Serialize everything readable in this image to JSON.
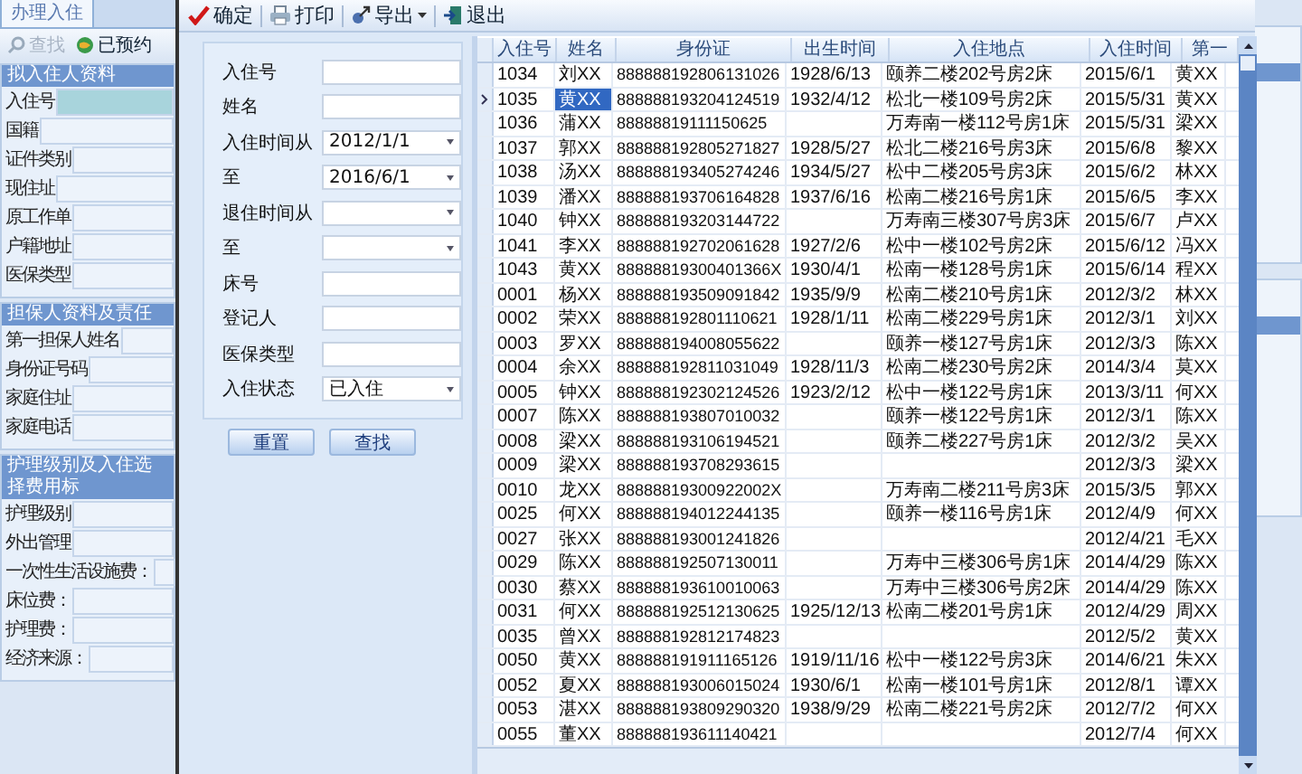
{
  "background_window": {
    "tab": {
      "label": "办理入住",
      "selected": true
    },
    "toolbar": [
      {
        "label": "查找",
        "kind": "search",
        "disabled": true
      },
      {
        "label": "已预约",
        "kind": "booked",
        "disabled": false
      }
    ],
    "sections": [
      {
        "title": "拟入住人资料",
        "fields": [
          {
            "label": "入住号",
            "highlighted": true
          },
          {
            "label": "国籍",
            "highlighted": false
          },
          {
            "label": "证件类别",
            "highlighted": false
          },
          {
            "label": "现住址",
            "highlighted": false
          },
          {
            "label": "原工作单",
            "highlighted": false
          },
          {
            "label": "户籍地址",
            "highlighted": false
          },
          {
            "label": "医保类型",
            "highlighted": false
          }
        ]
      },
      {
        "title": "担保人资料及责任",
        "fields": [
          {
            "label": "第一担保人姓名",
            "highlighted": false
          },
          {
            "label": "身份证号码",
            "highlighted": false
          },
          {
            "label": "家庭住址",
            "highlighted": false
          },
          {
            "label": "家庭电话",
            "highlighted": false
          }
        ]
      },
      {
        "title": "护理级别及入住选择费用标",
        "fields": [
          {
            "label": "护理级别",
            "highlighted": false
          },
          {
            "label": "外出管理",
            "highlighted": false
          },
          {
            "label": "一次性生活设施费：",
            "highlighted": false
          },
          {
            "label": "床位费：",
            "highlighted": false
          },
          {
            "label": "护理费：",
            "highlighted": false
          },
          {
            "label": "经济来源：",
            "highlighted": false
          }
        ]
      }
    ]
  },
  "dialog": {
    "toolbar": [
      {
        "label": "确定",
        "kind": "confirm",
        "dropdown": false
      },
      {
        "label": "打印",
        "kind": "print",
        "dropdown": false
      },
      {
        "label": "导出",
        "kind": "export",
        "dropdown": true
      },
      {
        "label": "退出",
        "kind": "exit",
        "dropdown": false
      }
    ],
    "filters": [
      {
        "label": "入住号",
        "kind": "text"
      },
      {
        "label": "姓名",
        "kind": "text"
      },
      {
        "label": "入住时间从",
        "kind": "combo",
        "value": "2012/1/1"
      },
      {
        "label": "至",
        "kind": "combo",
        "value": "2016/6/1"
      },
      {
        "label": "退住时间从",
        "kind": "combo"
      },
      {
        "label": "至",
        "kind": "combo"
      },
      {
        "label": "床号",
        "kind": "text"
      },
      {
        "label": "登记人",
        "kind": "text"
      },
      {
        "label": "医保类型",
        "kind": "text"
      },
      {
        "label": "入住状态",
        "kind": "combo",
        "value": "已入住"
      }
    ],
    "buttons": [
      "重置",
      "查找"
    ],
    "table": {
      "columns": [
        "入住号",
        "姓名",
        "身份证",
        "出生时间",
        "入住地点",
        "入住时间",
        "第一"
      ],
      "rows": [
        {
          "selected": false,
          "cells": [
            "1034",
            "刘XX",
            "888888192806131026",
            "1928/6/13",
            "颐养二楼202号房2床",
            "2015/6/1",
            "黄XX"
          ]
        },
        {
          "selected": true,
          "cells": [
            "1035",
            "黄XX",
            "888888193204124519",
            "1932/4/12",
            "松北一楼109号房2床",
            "2015/5/31",
            "黄XX"
          ]
        },
        {
          "selected": false,
          "cells": [
            "1036",
            "蒲XX",
            "88888819111150625",
            null,
            "万寿南一楼112号房1床",
            "2015/5/31",
            "梁XX"
          ]
        },
        {
          "selected": false,
          "cells": [
            "1037",
            "郭XX",
            "888888192805271827",
            "1928/5/27",
            "松北二楼216号房3床",
            "2015/6/8",
            "黎XX"
          ]
        },
        {
          "selected": false,
          "cells": [
            "1038",
            "汤XX",
            "888888193405274246",
            "1934/5/27",
            "松中二楼205号房3床",
            "2015/6/2",
            "林XX"
          ]
        },
        {
          "selected": false,
          "cells": [
            "1039",
            "潘XX",
            "888888193706164828",
            "1937/6/16",
            "松南二楼216号房1床",
            "2015/6/5",
            "李XX"
          ]
        },
        {
          "selected": false,
          "cells": [
            "1040",
            "钟XX",
            "888888193203144722",
            null,
            "万寿南三楼307号房3床",
            "2015/6/7",
            "卢XX"
          ]
        },
        {
          "selected": false,
          "cells": [
            "1041",
            "李XX",
            "888888192702061628",
            "1927/2/6",
            "松中一楼102号房2床",
            "2015/6/12",
            "冯XX"
          ]
        },
        {
          "selected": false,
          "cells": [
            "1043",
            "黄XX",
            "88888819300401366X",
            "1930/4/1",
            "松南一楼128号房1床",
            "2015/6/14",
            "程XX"
          ]
        },
        {
          "selected": false,
          "cells": [
            "0001",
            "杨XX",
            "888888193509091842",
            "1935/9/9",
            "松南二楼210号房1床",
            "2012/3/2",
            "林XX"
          ]
        },
        {
          "selected": false,
          "cells": [
            "0002",
            "荣XX",
            "888888192801110621",
            "1928/1/11",
            "松南二楼229号房1床",
            "2012/3/1",
            "刘XX"
          ]
        },
        {
          "selected": false,
          "cells": [
            "0003",
            "罗XX",
            "888888194008055622",
            null,
            "颐养一楼127号房1床",
            "2012/3/3",
            "陈XX"
          ]
        },
        {
          "selected": false,
          "cells": [
            "0004",
            "余XX",
            "888888192811031049",
            "1928/11/3",
            "松南二楼230号房2床",
            "2014/3/4",
            "莫XX"
          ]
        },
        {
          "selected": false,
          "cells": [
            "0005",
            "钟XX",
            "888888192302124526",
            "1923/2/12",
            "松中一楼122号房1床",
            "2013/3/11",
            "何XX"
          ]
        },
        {
          "selected": false,
          "cells": [
            "0007",
            "陈XX",
            "888888193807010032",
            null,
            "颐养一楼122号房1床",
            "2012/3/1",
            "陈XX"
          ]
        },
        {
          "selected": false,
          "cells": [
            "0008",
            "梁XX",
            "888888193106194521",
            null,
            "颐养二楼227号房1床",
            "2012/3/2",
            "吴XX"
          ]
        },
        {
          "selected": false,
          "cells": [
            "0009",
            "梁XX",
            "888888193708293615",
            null,
            null,
            "2012/3/3",
            "梁XX"
          ]
        },
        {
          "selected": false,
          "cells": [
            "0010",
            "龙XX",
            "88888819300922002X",
            null,
            "万寿南二楼211号房3床",
            "2015/3/5",
            "郭XX"
          ]
        },
        {
          "selected": false,
          "cells": [
            "0025",
            "何XX",
            "888888194012244135",
            null,
            "颐养一楼116号房1床",
            "2012/4/9",
            "何XX"
          ]
        },
        {
          "selected": false,
          "cells": [
            "0027",
            "张XX",
            "888888193001241826",
            null,
            null,
            "2012/4/21",
            "毛XX"
          ]
        },
        {
          "selected": false,
          "cells": [
            "0029",
            "陈XX",
            "888888192507130011",
            null,
            "万寿中三楼306号房1床",
            "2014/4/29",
            "陈XX"
          ]
        },
        {
          "selected": false,
          "cells": [
            "0030",
            "蔡XX",
            "888888193610010063",
            null,
            "万寿中三楼306号房2床",
            "2014/4/29",
            "陈XX"
          ]
        },
        {
          "selected": false,
          "cells": [
            "0031",
            "何XX",
            "888888192512130625",
            "1925/12/13",
            "松南二楼201号房1床",
            "2012/4/29",
            "周XX"
          ]
        },
        {
          "selected": false,
          "cells": [
            "0035",
            "曾XX",
            "888888192812174823",
            null,
            null,
            "2012/5/2",
            "黄XX"
          ]
        },
        {
          "selected": false,
          "cells": [
            "0050",
            "黄XX",
            "888888191911165126",
            "1919/11/16",
            "松中一楼122号房3床",
            "2014/6/21",
            "朱XX"
          ]
        },
        {
          "selected": false,
          "cells": [
            "0052",
            "夏XX",
            "888888193006015024",
            "1930/6/1",
            "松南一楼101号房1床",
            "2012/8/1",
            "谭XX"
          ]
        },
        {
          "selected": false,
          "cells": [
            "0053",
            "湛XX",
            "888888193809290320",
            "1938/9/29",
            "松南二楼221号房2床",
            "2012/7/2",
            "何XX"
          ]
        },
        {
          "selected": false,
          "cells": [
            "0055",
            "董XX",
            "888888193611140421",
            null,
            null,
            "2012/7/4",
            "何XX"
          ]
        }
      ]
    }
  }
}
